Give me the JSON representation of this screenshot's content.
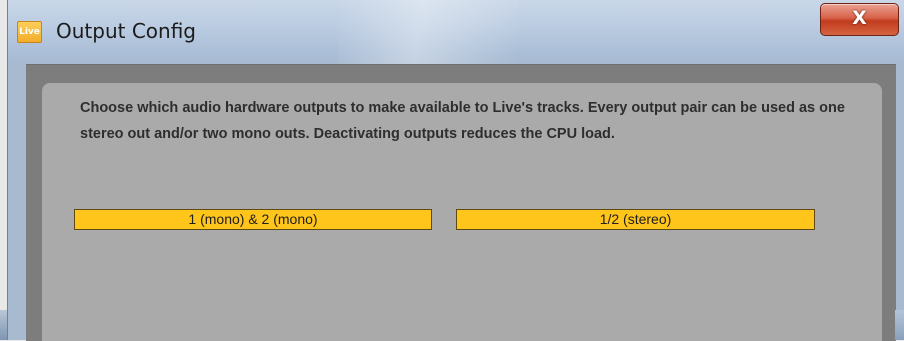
{
  "window": {
    "title": "Output Config",
    "app_icon_text": "Live",
    "close_glyph": "X"
  },
  "panel": {
    "description": "Choose which audio hardware outputs to make available to Live's tracks. Every output pair can be used as one stereo out and/or two mono outs.  Deactivating outputs reduces the CPU load.",
    "outputs": [
      {
        "label": "1 (mono) & 2 (mono)"
      },
      {
        "label": "1/2 (stereo)"
      }
    ]
  },
  "colors": {
    "button_active": "#ffc51a",
    "panel_bg": "#aaaaaa",
    "frame_bg": "#7d7d7d",
    "close_button": "#c13b1f"
  },
  "icons": {
    "app": "live-app-icon",
    "close": "close-icon"
  }
}
